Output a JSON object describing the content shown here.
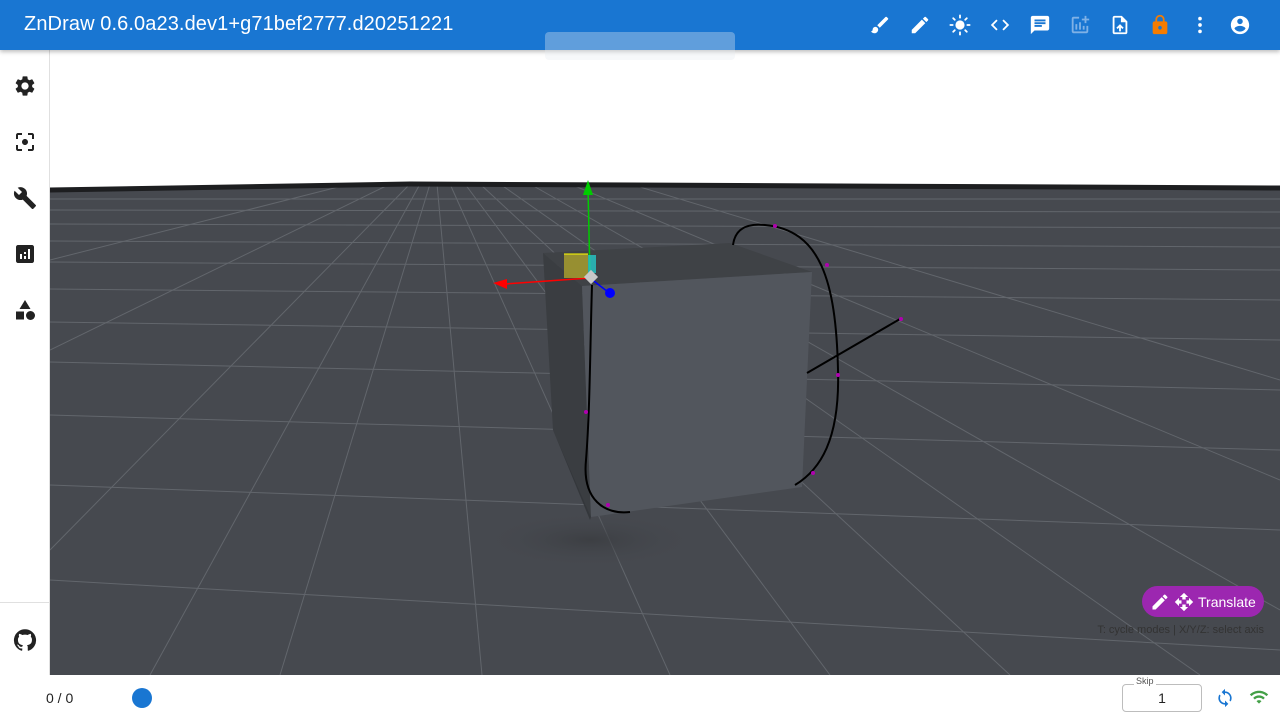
{
  "app": {
    "title": "ZnDraw 0.6.0a23.dev1+g71bef2777.d20251221"
  },
  "toolbar": {
    "items": [
      {
        "name": "brush-icon",
        "tooltip": ""
      },
      {
        "name": "pencil-icon",
        "tooltip": ""
      },
      {
        "name": "brightness-icon",
        "tooltip": ""
      },
      {
        "name": "code-icon",
        "tooltip": ""
      },
      {
        "name": "chat-icon",
        "tooltip": ""
      },
      {
        "name": "add-chart-icon",
        "tooltip": ""
      },
      {
        "name": "upload-file-icon",
        "tooltip": ""
      },
      {
        "name": "lock-icon",
        "tooltip": ""
      },
      {
        "name": "more-vert-icon",
        "tooltip": ""
      },
      {
        "name": "account-circle-icon",
        "tooltip": ""
      }
    ]
  },
  "sidebar": {
    "items": [
      {
        "name": "gear-icon"
      },
      {
        "name": "center-focus-icon"
      },
      {
        "name": "wrench-icon"
      },
      {
        "name": "analytics-icon"
      },
      {
        "name": "shapes-icon"
      }
    ],
    "footer": {
      "name": "github-icon"
    }
  },
  "viewport": {
    "mode_label": "Translate",
    "hint": "T: cycle modes | X/Y/Z: select axis",
    "colors": {
      "background": "#ffffff",
      "floor": "#46494f",
      "grid": "#62666c",
      "cube_top": "#3f4246",
      "cube_front": "#52565d",
      "cube_side": "#3a3d41",
      "curve": "#000000",
      "curve_points": "#b000b0",
      "axis_x": "#ff0000",
      "axis_y": "#00cc00",
      "axis_z": "#0000ff",
      "mode_chip": "#9c27b0"
    }
  },
  "player": {
    "frame_counter": "0 / 0",
    "skip_label": "Skip",
    "skip_value": "1"
  },
  "colors": {
    "appbar": "#1976d2",
    "accent": "#1976d2",
    "lock": "#f57c00",
    "connected": "#43a047"
  }
}
